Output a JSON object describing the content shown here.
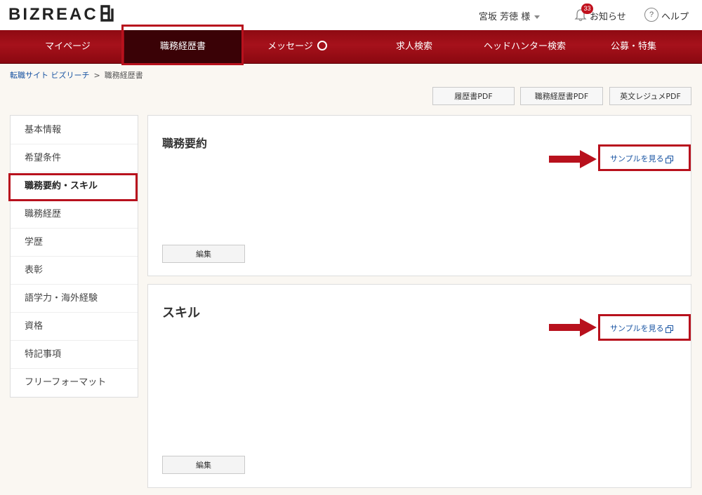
{
  "header": {
    "logo": "BIZREAC",
    "user_name": "宮坂 芳徳 様",
    "notifications": {
      "count": "33",
      "label": "お知らせ"
    },
    "help": {
      "icon_text": "?",
      "label": "ヘルプ"
    }
  },
  "nav": {
    "items": [
      {
        "label": "マイページ"
      },
      {
        "label": "職務経歴書"
      },
      {
        "label": "メッセージ"
      },
      {
        "label": "求人検索"
      },
      {
        "label": "ヘッドハンター検索"
      },
      {
        "label": "公募・特集"
      }
    ]
  },
  "breadcrumb": {
    "home": "転職サイト ビズリーチ",
    "separator": ">",
    "current": "職務経歴書"
  },
  "pdf_buttons": [
    "履歴書PDF",
    "職務経歴書PDF",
    "英文レジュメPDF"
  ],
  "sidebar": {
    "items": [
      "基本情報",
      "希望条件",
      "職務要約・スキル",
      "職務経歴",
      "学歴",
      "表彰",
      "語学力・海外経験",
      "資格",
      "特記事項",
      "フリーフォーマット"
    ],
    "active_index": 2
  },
  "sections": [
    {
      "title": "職務要約",
      "sample_link": "サンプルを見る",
      "edit_label": "編集"
    },
    {
      "title": "スキル",
      "sample_link": "サンプルを見る",
      "edit_label": "編集"
    }
  ],
  "colors": {
    "brand_red": "#b8111d",
    "nav_red": "#a6111b",
    "nav_active": "#3a0206",
    "link_blue": "#1a55a3"
  }
}
